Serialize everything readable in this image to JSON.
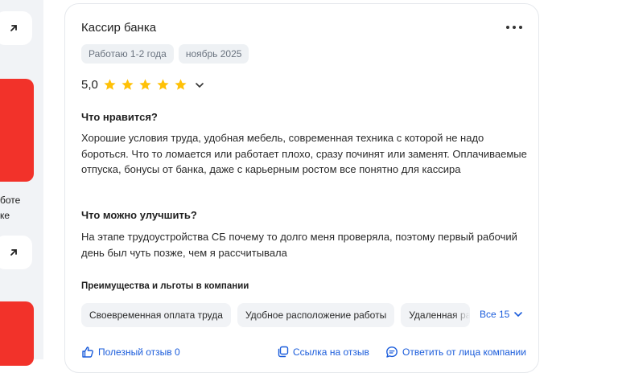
{
  "left_column": {
    "text_line1": "боте",
    "text_line2": "ке",
    "arrow_glyph": "↗"
  },
  "review": {
    "title": "Кассир банка",
    "tags": [
      "Работаю 1-2 года",
      "ноябрь 2025"
    ],
    "rating": "5,0",
    "stars": 5,
    "likes_head": "Что нравится?",
    "likes_text": "Хорошие условия труда, удобная мебель, современная техника с которой не надо бороться. Что то ломается или работает плохо, сразу починят или заменят. Оплачиваемые отпуска, бонусы от банка, даже с карьерным ростом все понятно для кассира",
    "improve_head": "Что можно улучшить?",
    "improve_text": "На этапе трудоустройства СБ почему то долго меня проверяла, поэтому первый рабочий день был чуть позже, чем я рассчитывала",
    "benefits_head": "Преимущества и льготы в компании",
    "benefits": [
      "Своевременная оплата труда",
      "Удобное расположение работы",
      "Удаленная работа"
    ],
    "all_benefits_label": "Все 15",
    "helpful_label": "Полезный отзыв 0",
    "link_label": "Ссылка на отзыв",
    "reply_label": "Ответить от лица компании"
  },
  "colors": {
    "accent": "#1a5cdb",
    "star": "#ffc107",
    "brand_red": "#f2322a"
  }
}
